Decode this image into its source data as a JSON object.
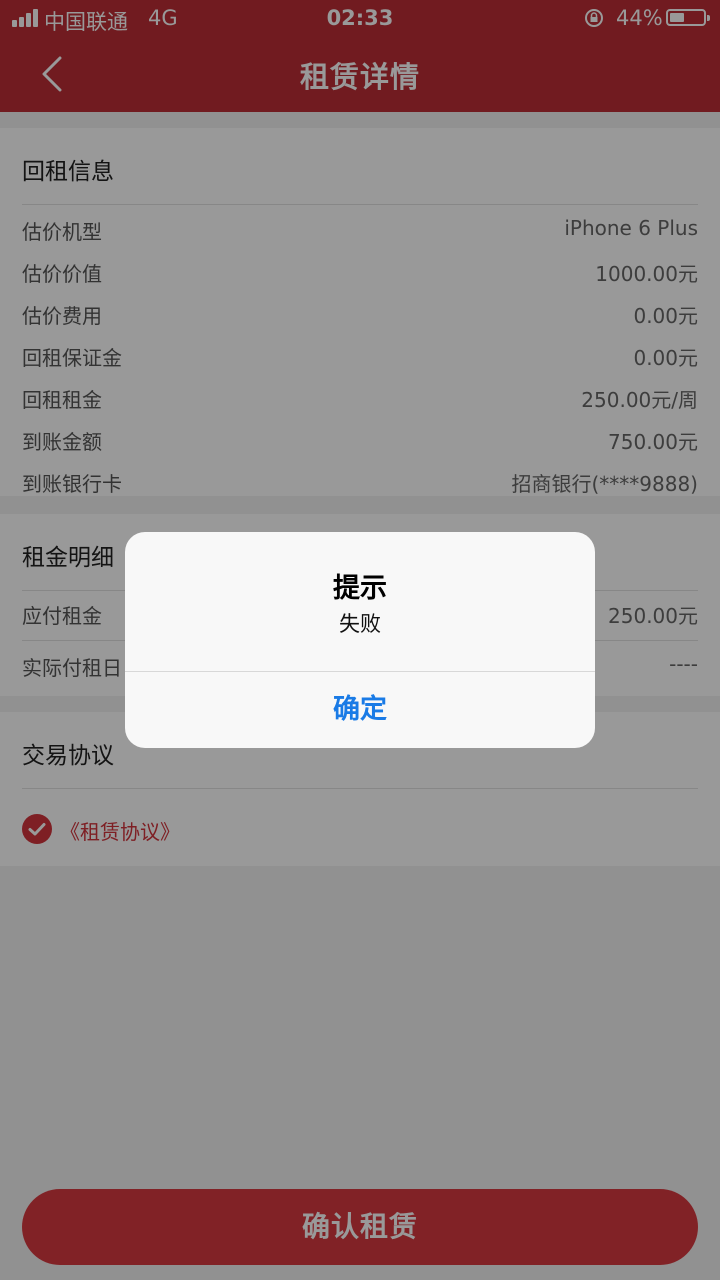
{
  "status_bar": {
    "carrier": "中国联通",
    "network": "4G",
    "time": "02:33",
    "battery": "44%",
    "battery_level": 0.44
  },
  "nav": {
    "title": "租赁详情",
    "back_icon": "chevron-left-icon"
  },
  "rental_info": {
    "title": "回租信息",
    "rows": [
      {
        "label": "估价机型",
        "value": "iPhone 6 Plus"
      },
      {
        "label": "估价价值",
        "value": "1000.00元"
      },
      {
        "label": "估价费用",
        "value": "0.00元"
      },
      {
        "label": "回租保证金",
        "value": "0.00元"
      },
      {
        "label": "回租租金",
        "value": "250.00元/周"
      },
      {
        "label": "到账金额",
        "value": "750.00元"
      },
      {
        "label": "到账银行卡",
        "value": "招商银行(****9888)"
      }
    ]
  },
  "rent_detail": {
    "title": "租金明细",
    "rows": [
      {
        "label": "应付租金",
        "value": "250.00元"
      },
      {
        "label": "实际付租日",
        "value": "----"
      }
    ]
  },
  "agreement": {
    "title": "交易协议",
    "link": "《租赁协议》",
    "checked": true
  },
  "confirm_button": "确认租赁",
  "dialog": {
    "title": "提示",
    "message": "失败",
    "button": "确定"
  },
  "colors": {
    "brand_red": "#bd2e36",
    "button_red": "#d83a40",
    "dialog_link": "#1a7be6"
  }
}
